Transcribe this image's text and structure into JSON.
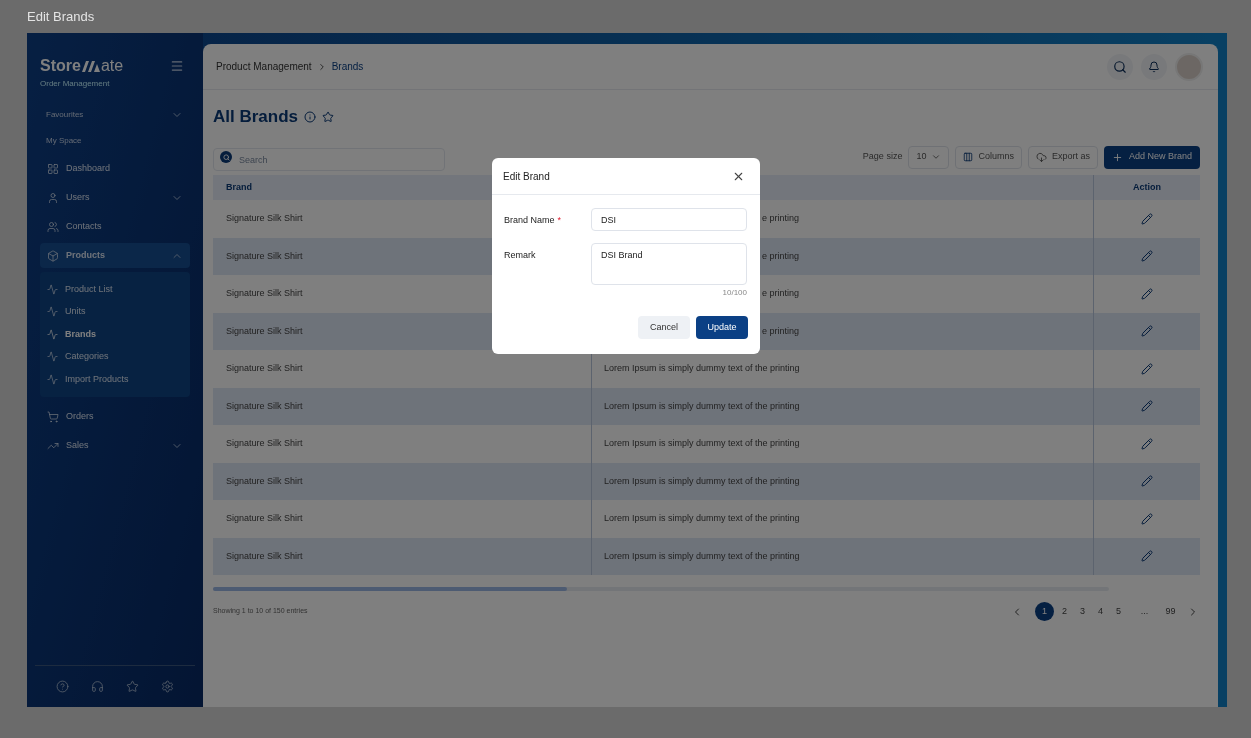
{
  "window": {
    "title": "Edit Brands"
  },
  "sidebar": {
    "logo": {
      "left": "Store",
      "right": "ate"
    },
    "tagline": "Order Management",
    "items": [
      {
        "kind": "group",
        "label": "Favourites",
        "expanded": false
      },
      {
        "kind": "heading",
        "label": "My Space"
      },
      {
        "kind": "link",
        "label": "Dashboard",
        "selected": false
      },
      {
        "kind": "link",
        "label": "Users",
        "selected": false,
        "expanded": false
      },
      {
        "kind": "link",
        "label": "Contacts",
        "selected": false
      },
      {
        "kind": "link",
        "label": "Products",
        "selected": true,
        "expanded": true,
        "children": [
          {
            "label": "Product List",
            "selected": false
          },
          {
            "label": "Units",
            "selected": false
          },
          {
            "label": "Brands",
            "selected": true
          },
          {
            "label": "Categories",
            "selected": false
          },
          {
            "label": "Import Products",
            "selected": false
          }
        ]
      },
      {
        "kind": "link",
        "label": "Orders",
        "selected": false
      },
      {
        "kind": "link",
        "label": "Sales",
        "selected": false,
        "expanded": false
      }
    ]
  },
  "header": {
    "breadcrumb": [
      "Product Management",
      "Brands"
    ]
  },
  "page": {
    "title": "All Brands",
    "search": {
      "placeholder": "Search"
    },
    "page_size_label": "Page size",
    "page_size": "10",
    "columns_button": "Columns",
    "export_button": "Export as",
    "add_button": "Add New Brand"
  },
  "table": {
    "columns": {
      "brand": "Brand",
      "action": "Action"
    },
    "rows": [
      {
        "brand": "Signature Silk Shirt",
        "column_2": "e printing",
        "covered": true
      },
      {
        "brand": "Signature Silk Shirt",
        "column_2": "e printing",
        "covered": true
      },
      {
        "brand": "Signature Silk Shirt",
        "column_2": "e printing",
        "covered": true
      },
      {
        "brand": "Signature Silk Shirt",
        "column_2": "e printing",
        "covered": true
      },
      {
        "brand": "Signature Silk Shirt",
        "column_2": "Lorem Ipsum is simply dummy text of the printing",
        "covered": false
      },
      {
        "brand": "Signature Silk Shirt",
        "column_2": "Lorem Ipsum is simply dummy text of the printing",
        "covered": false
      },
      {
        "brand": "Signature Silk Shirt",
        "column_2": "Lorem Ipsum is simply dummy text of the printing",
        "covered": false
      },
      {
        "brand": "Signature Silk Shirt",
        "column_2": "Lorem Ipsum is simply dummy text of the printing",
        "covered": false
      },
      {
        "brand": "Signature Silk Shirt",
        "column_2": "Lorem Ipsum is simply dummy text of the printing",
        "covered": false
      },
      {
        "brand": "Signature Silk Shirt",
        "column_2": "Lorem Ipsum is simply dummy text of the printing",
        "covered": false
      }
    ]
  },
  "footer": {
    "summary": "Showing 1 to 10 of 150 entries",
    "pages": [
      {
        "label": "1",
        "selected": true
      },
      {
        "label": "2",
        "selected": false
      },
      {
        "label": "3",
        "selected": false
      },
      {
        "label": "4",
        "selected": false
      },
      {
        "label": "5",
        "selected": false
      },
      {
        "label": "...",
        "selected": false
      },
      {
        "label": "99",
        "selected": false
      }
    ]
  },
  "modal": {
    "title": "Edit Brand",
    "fields": [
      {
        "kind": "input",
        "label": "Brand Name",
        "mark": "*",
        "value": "DSI"
      },
      {
        "kind": "textarea",
        "label": "Remark",
        "value": "DSI Brand",
        "counter": "10/100"
      }
    ],
    "cancel": "Cancel",
    "submit": "Update"
  }
}
